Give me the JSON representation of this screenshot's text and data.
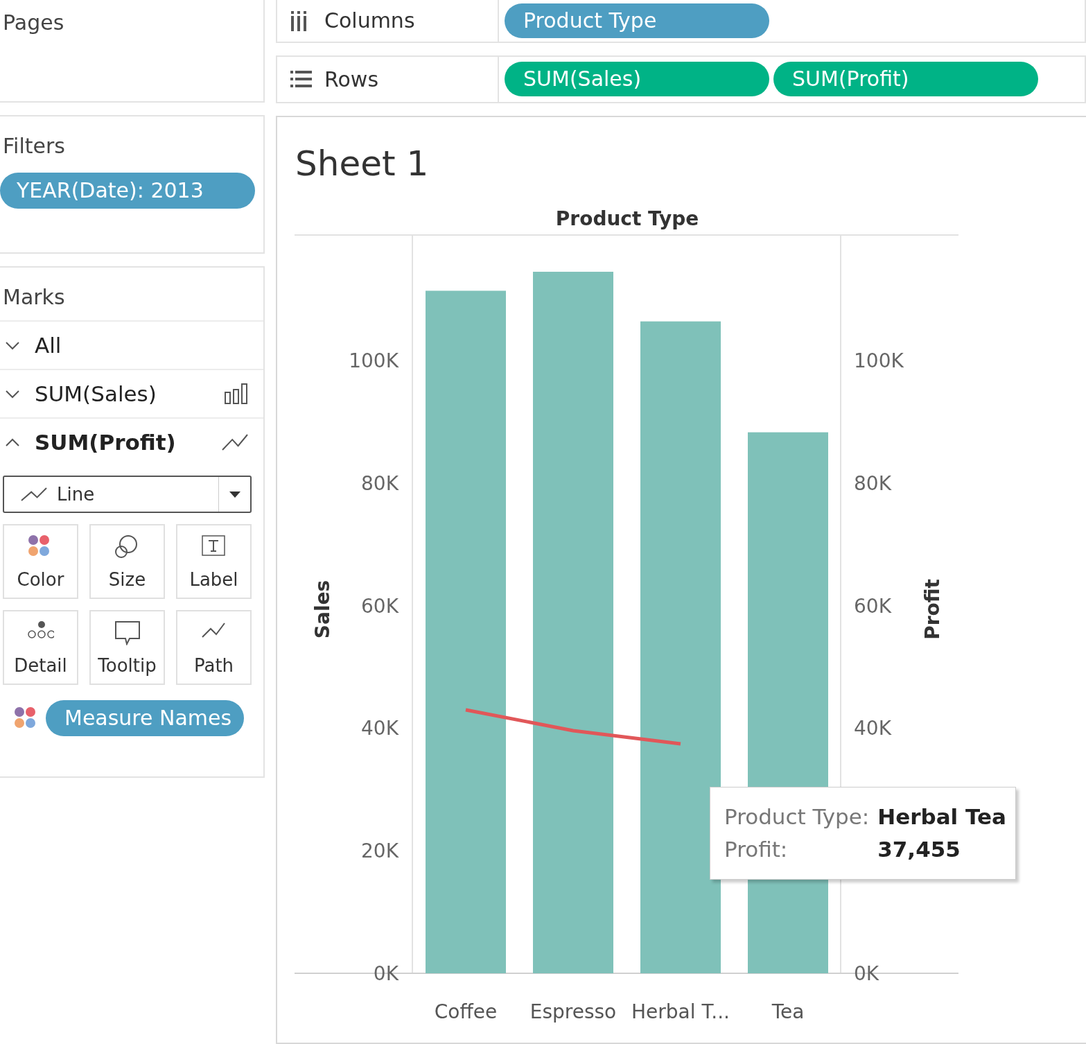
{
  "pages": {
    "title": "Pages"
  },
  "filters": {
    "title": "Filters",
    "pills": [
      {
        "label": "YEAR(Date): 2013",
        "color": "#4e9ec2"
      }
    ]
  },
  "marks": {
    "title": "Marks",
    "layers": [
      {
        "label": "All",
        "kind": "none",
        "expanded": false
      },
      {
        "label": "SUM(Sales)",
        "kind": "bar",
        "expanded": false
      },
      {
        "label": "SUM(Profit)",
        "kind": "line",
        "expanded": true
      }
    ],
    "mark_type": {
      "label": "Line",
      "kind": "line"
    },
    "cards": [
      {
        "label": "Color",
        "kind": "color"
      },
      {
        "label": "Size",
        "kind": "size"
      },
      {
        "label": "Label",
        "kind": "label"
      },
      {
        "label": "Detail",
        "kind": "detail"
      },
      {
        "label": "Tooltip",
        "kind": "tooltip"
      },
      {
        "label": "Path",
        "kind": "path"
      }
    ],
    "pills": [
      {
        "label": "Measure Names",
        "kind": "color",
        "color": "#4e9ec2"
      }
    ]
  },
  "shelves": [
    {
      "label": "Columns",
      "kind": "columns",
      "pills": [
        {
          "label": "Product Type",
          "color": "#4e9ec2"
        }
      ]
    },
    {
      "label": "Rows",
      "kind": "rows",
      "pills": [
        {
          "label": "SUM(Sales)",
          "color": "#00b386"
        },
        {
          "label": "SUM(Profit)",
          "color": "#00b386"
        }
      ]
    }
  ],
  "sheet": {
    "title": "Sheet 1",
    "chart_data": {
      "type": "bar",
      "title": "Product Type",
      "ylabel": "Sales",
      "stacked": false,
      "categories": [
        "Coffee",
        "Espresso",
        "Herbal T...",
        "Tea"
      ],
      "values": [
        111400,
        114500,
        106400,
        88300
      ],
      "ylim": [
        0,
        120500
      ],
      "yticks": [
        {
          "value": 0,
          "label": "0K"
        },
        {
          "value": 20000,
          "label": "20K"
        },
        {
          "value": 40000,
          "label": "40K"
        },
        {
          "value": 60000,
          "label": "60K"
        },
        {
          "value": 80000,
          "label": "80K"
        },
        {
          "value": 100000,
          "label": "100K"
        }
      ]
    },
    "profit_axis": {
      "chart_data": {
        "type": "line",
        "ylabel": "Profit",
        "values": [
          43000,
          39600,
          37455,
          null
        ],
        "ylim": [
          0,
          120500
        ],
        "yticks": [
          {
            "value": 0,
            "label": "0K"
          },
          {
            "value": 40000,
            "label": "40K"
          },
          {
            "value": 60000,
            "label": "60K"
          },
          {
            "value": 80000,
            "label": "80K"
          },
          {
            "value": 100000,
            "label": "100K"
          }
        ]
      }
    },
    "tooltip": {
      "rows": [
        {
          "label": "Product Type:",
          "value": "Herbal Tea"
        },
        {
          "label": "Profit:",
          "value": "37,455"
        }
      ]
    }
  }
}
